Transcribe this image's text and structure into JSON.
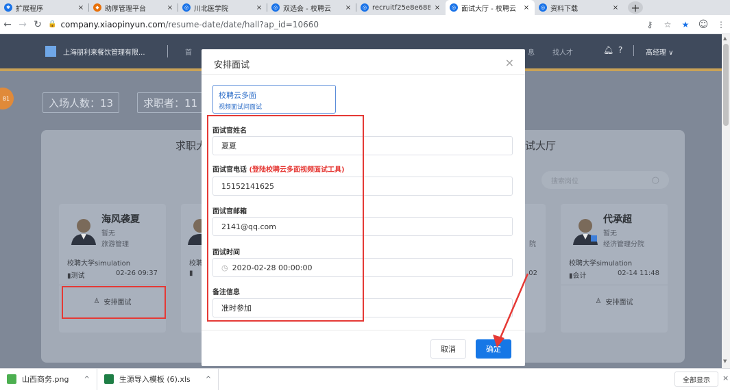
{
  "browser": {
    "tabs": [
      {
        "label": "扩展程序",
        "icon": "puzzle-icon",
        "color": "#1a73e8"
      },
      {
        "label": "助厚管理平台",
        "icon": "brand-icon",
        "color": "#e8710a"
      },
      {
        "label": "川北医学院",
        "icon": "site-icon",
        "color": "#1a73e8"
      },
      {
        "label": "双选会 - 校聘云",
        "icon": "site-icon",
        "color": "#1a73e8"
      },
      {
        "label": "recruitf25e8e688",
        "icon": "site-icon",
        "color": "#1a73e8"
      },
      {
        "label": "面试大厅 - 校聘云",
        "icon": "site-icon",
        "color": "#1a73e8"
      },
      {
        "label": "资料下载",
        "icon": "site-icon",
        "color": "#1a73e8"
      }
    ],
    "tab_close_symbol": "×",
    "new_tab_symbol": "+",
    "url_host": "company.xiaopinyun.com",
    "url_path": "/resume-date/date/hall?ap_id=10660"
  },
  "app": {
    "company": "上海朋利来餐饮管理有限...",
    "nav_first": "首",
    "nav_info": "息",
    "nav_find": "找人才",
    "user": "高经理 ∨",
    "badge": "81",
    "stats": [
      {
        "label": "入场人数：13"
      },
      {
        "label": "求职者：11"
      }
    ],
    "panel_title_left": "求职大",
    "panel_title_right": "试大厅",
    "search_placeholder": "搜索岗位"
  },
  "cards": [
    {
      "name": "海风袭夏",
      "status": "暂无",
      "major": "旅游管理",
      "school": "校聘大学simulation",
      "tag": "测试",
      "time": "02-26 09:37",
      "action": "安排面试"
    },
    {
      "school": "校聘"
    },
    {
      "major": "院",
      "time": "02"
    },
    {
      "name": "代承超",
      "status": "暂无",
      "major": "经济管理分院",
      "school": "校聘大学simulation",
      "tag": "会计",
      "time": "02-14 11:48",
      "action": "安排面试"
    }
  ],
  "modal": {
    "title": "安排面试",
    "tool_name": "校聘云多面",
    "tool_desc": "视频面试间面试",
    "fields": [
      {
        "label": "面试官姓名",
        "hint": "",
        "value": "夏夏"
      },
      {
        "label": "面试官电话",
        "hint": "(登陆校聘云多面视频面试工具)",
        "value": "15152141625"
      },
      {
        "label": "面试官邮箱",
        "hint": "",
        "value": "2141@qq.com"
      },
      {
        "label": "面试时间",
        "hint": "",
        "value": "2020-02-28 00:00:00"
      },
      {
        "label": "备注信息",
        "hint": "",
        "value": "准时参加"
      }
    ],
    "cancel_label": "取消",
    "ok_label": "确定"
  },
  "downloads": {
    "items": [
      {
        "name": "山西商务.png",
        "icon": "image-file-icon",
        "color": "#4caf50"
      },
      {
        "name": "生源导入模板 (6).xls",
        "icon": "excel-file-icon",
        "color": "#1e7e45"
      }
    ],
    "show_all": "全部显示"
  },
  "colors": {
    "accent": "#1677e6",
    "highlight_box": "#e53935",
    "hint_red": "#e53935"
  }
}
